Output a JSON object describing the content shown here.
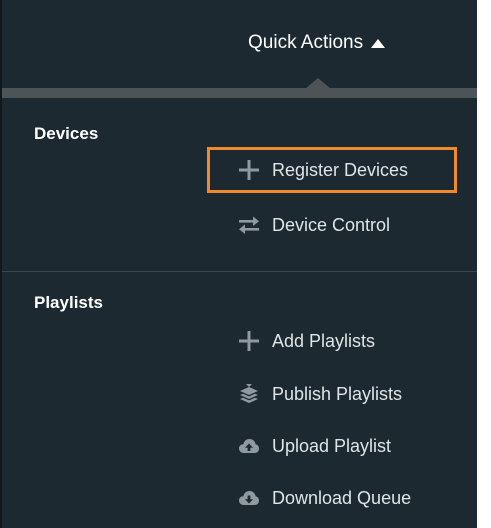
{
  "header": {
    "quick_actions_label": "Quick Actions",
    "caret_icon": "caret-up-icon"
  },
  "sections": {
    "devices": {
      "title": "Devices",
      "items": [
        {
          "label": "Register Devices",
          "icon": "plus-icon",
          "highlighted": true
        },
        {
          "label": "Device Control",
          "icon": "swap-arrows-icon"
        }
      ]
    },
    "playlists": {
      "title": "Playlists",
      "items": [
        {
          "label": "Add Playlists",
          "icon": "plus-icon"
        },
        {
          "label": "Publish Playlists",
          "icon": "publish-stack-icon"
        },
        {
          "label": "Upload Playlist",
          "icon": "cloud-upload-icon"
        },
        {
          "label": "Download Queue",
          "icon": "cloud-download-icon"
        }
      ]
    }
  },
  "colors": {
    "panel_background": "#1c2930",
    "divider": "#4d5458",
    "highlight_border": "#f08a2c",
    "item_text": "#dfe4e7",
    "icon_gray": "#8f9aa0"
  }
}
